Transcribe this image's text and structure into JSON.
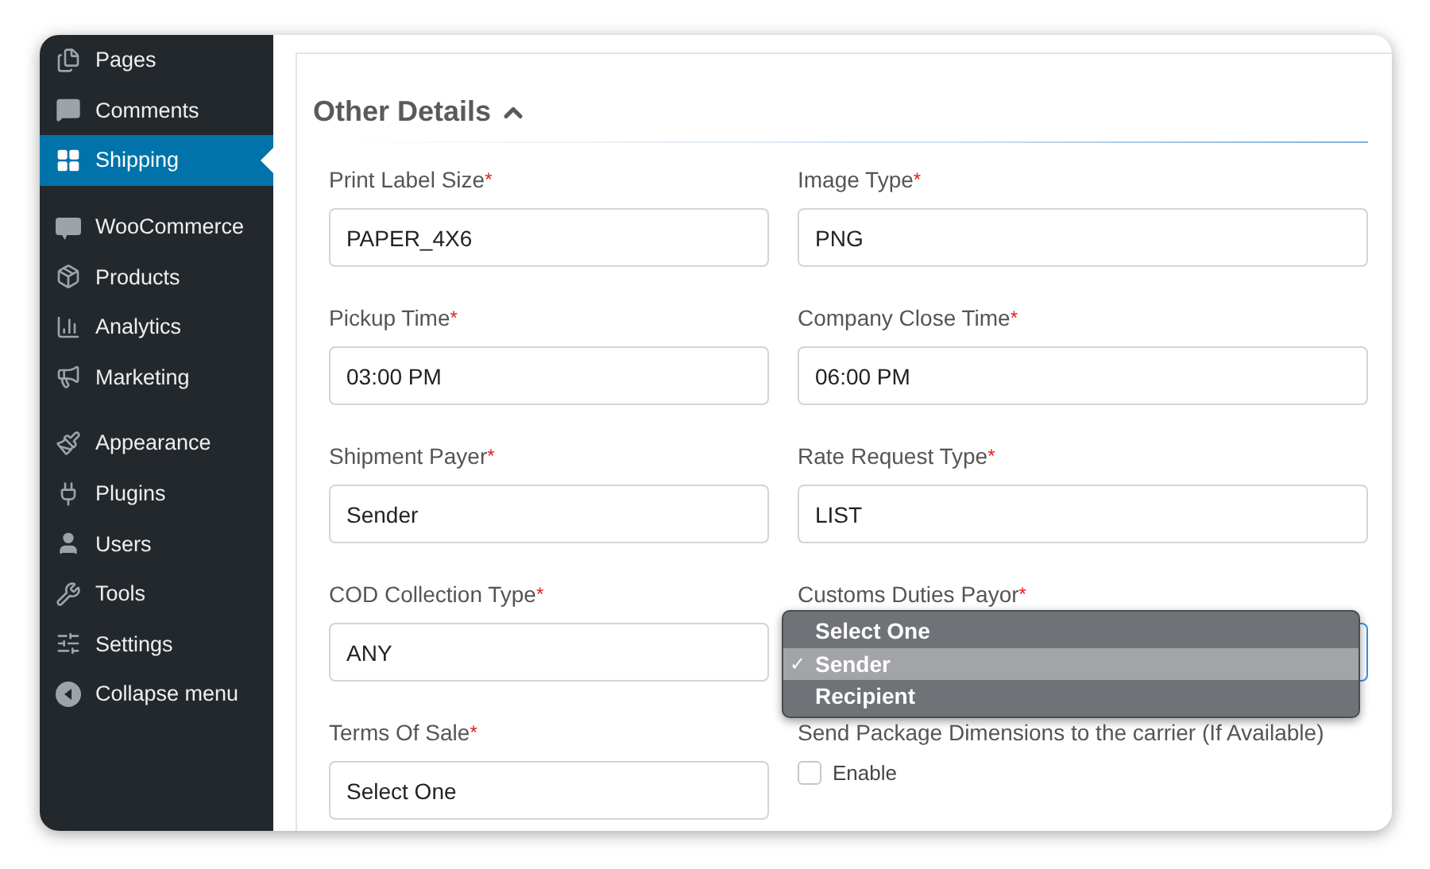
{
  "sidebar": {
    "groups": [
      [
        {
          "label": "Pages",
          "selected": false
        },
        {
          "label": "Comments",
          "selected": false
        },
        {
          "label": "Shipping",
          "selected": true
        }
      ],
      [
        {
          "label": "WooCommerce",
          "selected": false
        },
        {
          "label": "Products",
          "selected": false
        },
        {
          "label": "Analytics",
          "selected": false
        },
        {
          "label": "Marketing",
          "selected": false
        }
      ],
      [
        {
          "label": "Appearance",
          "selected": false
        },
        {
          "label": "Plugins",
          "selected": false
        },
        {
          "label": "Users",
          "selected": false
        },
        {
          "label": "Tools",
          "selected": false
        },
        {
          "label": "Settings",
          "selected": false
        },
        {
          "label": "Collapse menu",
          "selected": false
        }
      ]
    ]
  },
  "section": {
    "title": "Other Details",
    "expanded": true
  },
  "fields": [
    {
      "kind": "text",
      "label": "Print Label Size",
      "mark": "*",
      "value": "PAPER_4X6"
    },
    {
      "kind": "text",
      "label": "Image Type",
      "mark": "*",
      "value": "PNG"
    },
    {
      "kind": "text",
      "label": "Pickup Time",
      "mark": "*",
      "value": "03:00 PM"
    },
    {
      "kind": "text",
      "label": "Company Close Time",
      "mark": "*",
      "value": "06:00 PM"
    },
    {
      "kind": "text",
      "label": "Shipment Payer",
      "mark": "*",
      "value": "Sender"
    },
    {
      "kind": "text",
      "label": "Rate Request Type",
      "mark": "*",
      "value": "LIST"
    },
    {
      "kind": "text",
      "label": "COD Collection Type",
      "mark": "*",
      "value": "ANY"
    },
    {
      "kind": "select",
      "label": "Customs Duties Payor",
      "mark": "*",
      "focused": true,
      "options": [
        {
          "label": "Select One",
          "selected": false
        },
        {
          "label": "Sender",
          "selected": true,
          "tick": "✓"
        },
        {
          "label": "Recipient",
          "selected": false
        }
      ]
    },
    {
      "kind": "text",
      "label": "Terms Of Sale",
      "mark": "*",
      "value": "Select One"
    },
    {
      "kind": "checkbox",
      "label": "Send Package Dimensions to the carrier (If Available)",
      "option": "Enable",
      "checked": false
    }
  ]
}
